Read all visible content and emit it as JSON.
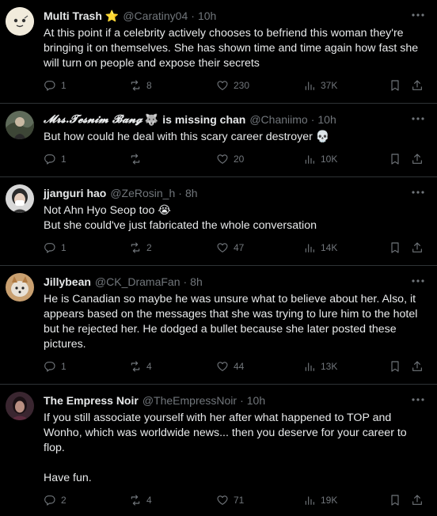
{
  "tweets": [
    {
      "name": "Multi Trash",
      "badge_emoji": "⭐",
      "handle": "@Caratiny04",
      "time": "10h",
      "text": "At this point if a celebrity actively chooses to befriend this woman they're bringing it on themselves. She has shown time and time again how fast she will turn on people and expose their secrets",
      "replies": "1",
      "reposts": "8",
      "likes": "230",
      "views": "37K"
    },
    {
      "name": "𝓜𝓻𝓼.𝓣𝓮𝓼𝓷𝓲𝓶 𝓑𝓪𝓷𝓰",
      "name_emoji": "🐺",
      "name_suffix": "is missing chan",
      "handle": "@Chaniimo",
      "time": "10h",
      "text": "But how could he deal with this scary career destroyer 💀",
      "replies": "1",
      "reposts": "",
      "likes": "20",
      "views": "10K"
    },
    {
      "name": "jjanguri hao",
      "handle": "@ZeRosin_h",
      "time": "8h",
      "text": "Not Ahn Hyo Seop too 😭\nBut she could've just fabricated the whole conversation",
      "replies": "1",
      "reposts": "2",
      "likes": "47",
      "views": "14K"
    },
    {
      "name": "Jillybean",
      "handle": "@CK_DramaFan",
      "time": "8h",
      "text": "He is Canadian so maybe he was unsure what to believe about her. Also, it appears based on the messages that she was trying to lure him to the hotel but he rejected her. He dodged a bullet because she later posted these pictures.",
      "replies": "1",
      "reposts": "4",
      "likes": "44",
      "views": "13K"
    },
    {
      "name": "The Empress Noir",
      "handle": "@TheEmpressNoir",
      "time": "10h",
      "text": "If you still associate yourself with her after what happened to TOP and Wonho, which was worldwide news... then you deserve for your career to flop.\n\nHave fun.",
      "replies": "2",
      "reposts": "4",
      "likes": "71",
      "views": "19K"
    }
  ],
  "icons": {
    "reply": "reply-icon",
    "repost": "repost-icon",
    "like": "like-icon",
    "views": "views-icon",
    "bookmark": "bookmark-icon",
    "share": "share-icon",
    "more": "more-icon"
  },
  "colors": {
    "background": "#000000",
    "text": "#e7e9ea",
    "secondary": "#71767b",
    "divider": "#2f3336",
    "star": "#f4a100"
  }
}
